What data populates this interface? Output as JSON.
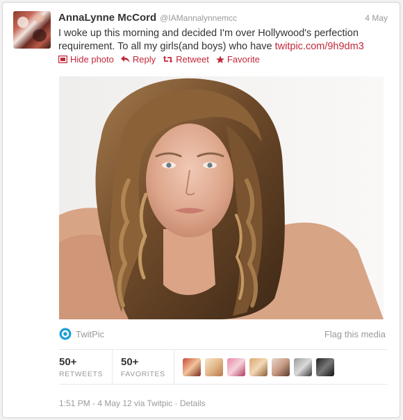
{
  "tweet": {
    "fullname": "AnnaLynne McCord",
    "username": "@IAMannalynnemcc",
    "date": "4 May",
    "text_before_link": "I woke up this morning and decided I'm over Hollywood's perfection requirement. To all my girls(and boys) who have ",
    "link_text": "twitpic.com/9h9dm3",
    "link_color": "#c0283b"
  },
  "actions": {
    "hide_photo": "Hide photo",
    "reply": "Reply",
    "retweet": "Retweet",
    "favorite": "Favorite"
  },
  "media": {
    "source_label": "TwitPic",
    "flag_label": "Flag this media"
  },
  "stats": {
    "retweets_count": "50+",
    "retweets_label": "RETWEETS",
    "favorites_count": "50+",
    "favorites_label": "FAVORITES",
    "avatar_count_shown": 7
  },
  "meta": {
    "timestamp": "1:51 PM - 4 May 12 via Twitpic",
    "separator": " · ",
    "details": "Details"
  },
  "icons": {
    "hide_photo": "photo-icon",
    "reply": "reply-arrow-icon",
    "retweet": "retweet-icon",
    "favorite": "star-icon",
    "source": "twitpic-logo-icon"
  }
}
